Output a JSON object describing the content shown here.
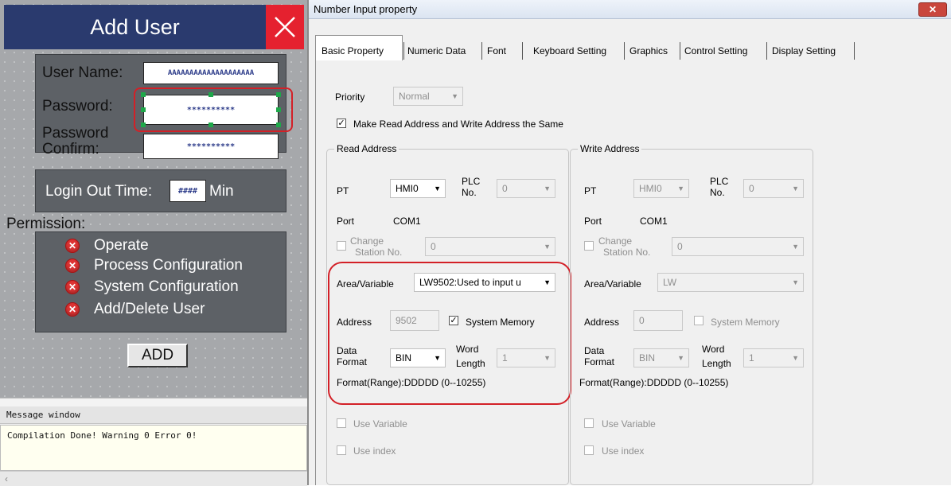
{
  "hmi": {
    "title": "Add User",
    "user_name_label": "User Name:",
    "user_name_value": "AAAAAAAAAAAAAAAAAAAA",
    "password_label": "Password:",
    "password_value": "**********",
    "password_confirm_label_1": "Password",
    "password_confirm_label_2": "Confirm:",
    "password_confirm_value": "**********",
    "logout_label": "Login Out Time:",
    "logout_value": "####",
    "logout_unit": "Min",
    "permission_label": "Permission:",
    "permissions": [
      "Operate",
      "Process Configuration",
      "System Configuration",
      "Add/Delete User"
    ],
    "add_button": "ADD"
  },
  "message_window": {
    "title": "Message window",
    "text": "Compilation Done! Warning 0 Error 0!"
  },
  "dialog": {
    "title": "Number Input property",
    "tabs": [
      "Basic Property",
      "Numeric Data",
      "Font",
      "Keyboard Setting",
      "Graphics",
      "Control Setting",
      "Display Setting"
    ],
    "priority_label": "Priority",
    "priority_value": "Normal",
    "same_address_label": "Make Read Address and Write Address the Same",
    "read": {
      "group_title": "Read Address",
      "pt_label": "PT",
      "pt_value": "HMI0",
      "plc_label_1": "PLC",
      "plc_label_2": "No.",
      "plc_value": "0",
      "port_label": "Port",
      "port_value": "COM1",
      "change_label_1": "Change",
      "change_label_2": "Station No.",
      "change_value": "0",
      "area_label": "Area/Variable",
      "area_value": "LW9502:Used to input u",
      "address_label": "Address",
      "address_value": "9502",
      "system_memory_label": "System Memory",
      "data_label_1": "Data",
      "data_label_2": "Format",
      "data_value": "BIN",
      "word_label_1": "Word",
      "word_label_2": "Length",
      "word_value": "1",
      "format_range": "Format(Range):DDDDD (0--10255)",
      "use_variable": "Use Variable",
      "use_index": "Use index"
    },
    "write": {
      "group_title": "Write Address",
      "pt_label": "PT",
      "pt_value": "HMI0",
      "plc_label_1": "PLC",
      "plc_label_2": "No.",
      "plc_value": "0",
      "port_label": "Port",
      "port_value": "COM1",
      "change_label_1": "Change",
      "change_label_2": "Station No.",
      "change_value": "0",
      "area_label": "Area/Variable",
      "area_value": "LW",
      "address_label": "Address",
      "address_value": "0",
      "system_memory_label": "System Memory",
      "data_label_1": "Data",
      "data_label_2": "Format",
      "data_value": "BIN",
      "word_label_1": "Word",
      "word_label_2": "Length",
      "word_value": "1",
      "format_range": "Format(Range):DDDDD (0--10255)",
      "use_variable": "Use Variable",
      "use_index": "Use index"
    }
  }
}
